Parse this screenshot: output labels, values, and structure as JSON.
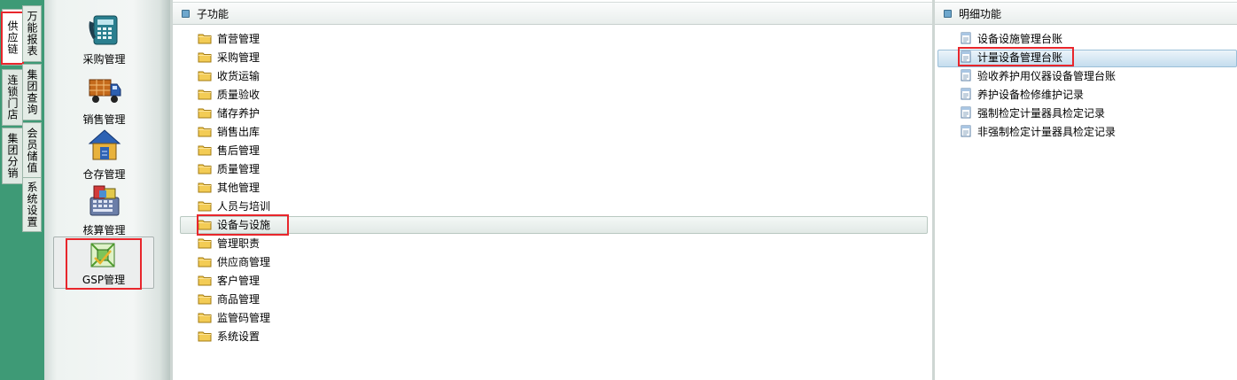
{
  "left_tabs": [
    {
      "label": "供应链",
      "active": true
    },
    {
      "label": "连锁门店",
      "active": false
    },
    {
      "label": "集团分销",
      "active": false
    }
  ],
  "inner_tabs": [
    {
      "label": "万能报表"
    },
    {
      "label": "集团查询"
    },
    {
      "label": "会员储值"
    },
    {
      "label": "系统设置"
    }
  ],
  "modules": [
    {
      "label": "采购管理",
      "icon": "phone-calculator-icon"
    },
    {
      "label": "销售管理",
      "icon": "delivery-truck-icon"
    },
    {
      "label": "仓存管理",
      "icon": "warehouse-house-icon"
    },
    {
      "label": "核算管理",
      "icon": "accounting-calculator-icon"
    },
    {
      "label": "GSP管理",
      "icon": "gsp-document-icon",
      "active": true
    }
  ],
  "sub_panel": {
    "title": "子功能",
    "items": [
      "首营管理",
      "采购管理",
      "收货运输",
      "质量验收",
      "储存养护",
      "销售出库",
      "售后管理",
      "质量管理",
      "其他管理",
      "人员与培训",
      "设备与设施",
      "管理职责",
      "供应商管理",
      "客户管理",
      "商品管理",
      "监管码管理",
      "系统设置"
    ],
    "selected": "设备与设施"
  },
  "detail_panel": {
    "title": "明细功能",
    "items": [
      "设备设施管理台账",
      "计量设备管理台账",
      "验收养护用仪器设备管理台账",
      "养护设备检修维护记录",
      "强制检定计量器具检定记录",
      "非强制检定计量器具检定记录"
    ],
    "selected": "计量设备管理台账"
  },
  "colors": {
    "sidebar_green": "#3e9a76",
    "highlight_red": "#e8262c",
    "folder_yellow": "#f3cc55"
  }
}
